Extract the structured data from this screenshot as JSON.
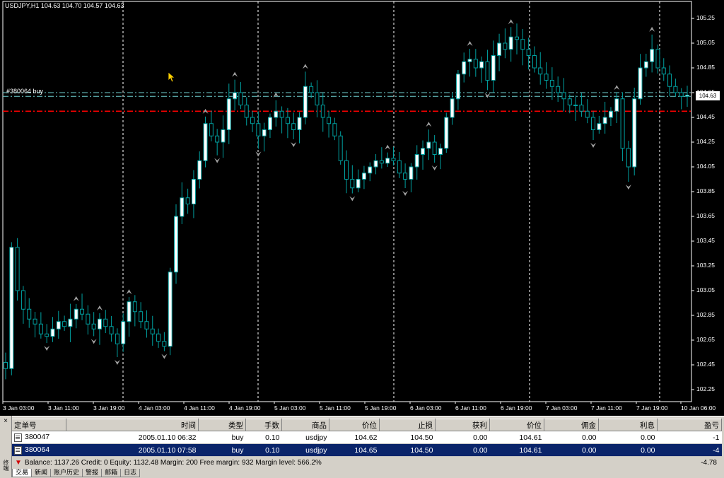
{
  "chart": {
    "title": "USDJPY,H1  104.63 104.70 104.57 104.63",
    "order_label": "#380064 buy",
    "current_price": "104.63",
    "y_ticks": [
      "105.25",
      "105.05",
      "104.85",
      "104.65",
      "104.45",
      "104.25",
      "104.05",
      "103.85",
      "103.65",
      "103.45",
      "103.25",
      "103.05",
      "102.85",
      "102.65",
      "102.45",
      "102.25"
    ],
    "x_ticks": [
      "3 Jan 03:00",
      "3 Jan 11:00",
      "3 Jan 19:00",
      "4 Jan 03:00",
      "4 Jan 11:00",
      "4 Jan 19:00",
      "5 Jan 03:00",
      "5 Jan 11:00",
      "5 Jan 19:00",
      "6 Jan 03:00",
      "6 Jan 11:00",
      "6 Jan 19:00",
      "7 Jan 03:00",
      "7 Jan 11:00",
      "7 Jan 19:00",
      "10 Jan 06:00"
    ],
    "colors": {
      "background": "#000000",
      "candle": "#00a0a0",
      "bull_body": "#ffffff",
      "order_line": "#6fd1d1",
      "stop_line": "#ff0000",
      "grid": "#ffffff"
    },
    "order_lines": [
      104.65,
      104.62
    ],
    "stop_loss": 104.5
  },
  "chart_data": {
    "type": "candlestick",
    "symbol": "USDJPY",
    "timeframe": "H1",
    "ylim": [
      102.2,
      105.4
    ],
    "closes": [
      102.42,
      103.4,
      103.05,
      102.9,
      102.82,
      102.78,
      102.7,
      102.68,
      102.74,
      102.8,
      102.76,
      102.82,
      102.9,
      102.86,
      102.78,
      102.74,
      102.82,
      102.76,
      102.7,
      102.62,
      102.8,
      102.96,
      102.88,
      102.8,
      102.74,
      102.7,
      102.64,
      102.6,
      103.2,
      103.65,
      103.8,
      103.75,
      103.95,
      104.1,
      104.4,
      104.3,
      104.25,
      104.35,
      104.6,
      104.65,
      104.55,
      104.45,
      104.4,
      104.3,
      104.35,
      104.45,
      104.5,
      104.45,
      104.4,
      104.35,
      104.45,
      104.7,
      104.65,
      104.55,
      104.45,
      104.4,
      104.3,
      104.1,
      103.95,
      103.88,
      103.95,
      104.0,
      104.05,
      104.1,
      104.08,
      104.12,
      104.1,
      104.0,
      103.95,
      104.05,
      104.15,
      104.2,
      104.25,
      104.15,
      104.2,
      104.45,
      104.6,
      104.8,
      104.9,
      104.92,
      104.85,
      104.9,
      104.75,
      104.95,
      105.05,
      105.0,
      105.1,
      105.08,
      105.0,
      104.95,
      104.85,
      104.8,
      104.75,
      104.7,
      104.65,
      104.6,
      104.55,
      104.55,
      104.5,
      104.45,
      104.35,
      104.4,
      104.45,
      104.5,
      104.6,
      104.2,
      104.05,
      104.6,
      104.85,
      104.9,
      105.0,
      104.85,
      104.8,
      104.7,
      104.65,
      104.62,
      104.63
    ]
  },
  "terminal": {
    "close_icon": "close-icon",
    "side_label": "终端",
    "columns": [
      "定单号",
      "时间",
      "类型",
      "手数",
      "商品",
      "价位",
      "止损",
      "获利",
      "价位",
      "佣金",
      "利息",
      "盈亏"
    ],
    "rows": [
      {
        "ticket": "380047",
        "time": "2005.01.10 06:32",
        "type": "buy",
        "lots": "0.10",
        "symbol": "usdjpy",
        "open_price": "104.62",
        "sl": "104.50",
        "tp": "0.00",
        "price": "104.61",
        "commission": "0.00",
        "swap": "0.00",
        "profit": "-1"
      },
      {
        "ticket": "380064",
        "time": "2005.01.10 07:58",
        "type": "buy",
        "lots": "0.10",
        "symbol": "usdjpy",
        "open_price": "104.65",
        "sl": "104.50",
        "tp": "0.00",
        "price": "104.61",
        "commission": "0.00",
        "swap": "0.00",
        "profit": "-4"
      }
    ],
    "summary": "Balance: 1137.26  Credit: 0  Equity: 1132.48  Margin: 200  Free margin: 932  Margin level: 566.2%",
    "total_profit": "-4.78",
    "tabs": [
      "交易",
      "新闻",
      "账户历史",
      "警报",
      "邮箱",
      "日志"
    ]
  }
}
